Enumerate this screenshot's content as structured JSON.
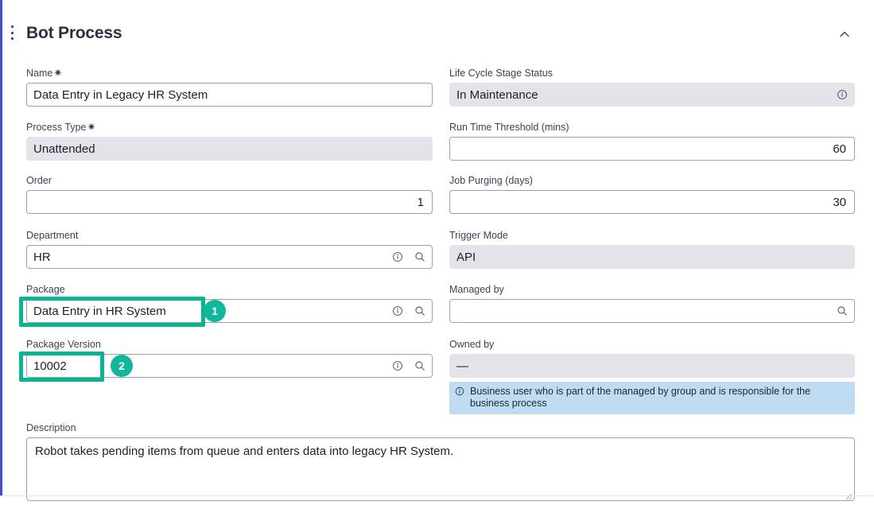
{
  "panel": {
    "title": "Bot Process",
    "drag_handle_icon": "kebab-vertical-icon",
    "collapse_icon": "chevron-up-icon",
    "collapsed": false
  },
  "colors": {
    "accent_rail": "#4a4ad0",
    "annotation_teal": "#09b393",
    "badge_teal": "#0fb89b",
    "callout_blue": "#bfdcf2",
    "disabled_grey": "#e2e4e9"
  },
  "required_marker": "✷",
  "form": {
    "left_column": [
      {
        "key": "name",
        "label": "Name",
        "required": true,
        "value": "Data Entry in Legacy HR System",
        "placeholder": "",
        "disabled": false,
        "align": "left",
        "adornments": []
      },
      {
        "key": "process_type",
        "label": "Process Type",
        "required": true,
        "value": "Unattended",
        "placeholder": "",
        "disabled": true,
        "align": "left",
        "adornments": []
      },
      {
        "key": "order",
        "label": "Order",
        "required": false,
        "value": "1",
        "placeholder": "",
        "disabled": false,
        "align": "right",
        "adornments": []
      },
      {
        "key": "department",
        "label": "Department",
        "required": false,
        "value": "HR",
        "placeholder": "",
        "disabled": false,
        "align": "left",
        "adornments": [
          "info-icon",
          "search-icon"
        ]
      },
      {
        "key": "package",
        "label": "Package",
        "required": false,
        "value": "Data Entry in HR System",
        "placeholder": "",
        "disabled": false,
        "align": "left",
        "adornments": [
          "info-icon",
          "search-icon"
        ]
      },
      {
        "key": "package_version",
        "label": "Package Version",
        "required": false,
        "value": "10002",
        "placeholder": "",
        "disabled": false,
        "align": "left",
        "adornments": [
          "info-icon",
          "search-icon"
        ]
      }
    ],
    "right_column": [
      {
        "key": "life_cycle_stage_status",
        "label": "Life Cycle Stage Status",
        "required": false,
        "value": "In Maintenance",
        "placeholder": "",
        "disabled": true,
        "align": "left",
        "adornments": [
          "info-icon"
        ]
      },
      {
        "key": "run_time_threshold",
        "label": "Run Time Threshold (mins)",
        "required": false,
        "value": "60",
        "placeholder": "",
        "disabled": false,
        "align": "right",
        "adornments": []
      },
      {
        "key": "job_purging",
        "label": "Job Purging (days)",
        "required": false,
        "value": "30",
        "placeholder": "",
        "disabled": false,
        "align": "right",
        "adornments": []
      },
      {
        "key": "trigger_mode",
        "label": "Trigger Mode",
        "required": false,
        "value": "API",
        "placeholder": "",
        "disabled": true,
        "align": "left",
        "adornments": []
      },
      {
        "key": "managed_by",
        "label": "Managed by",
        "required": false,
        "value": "",
        "placeholder": "",
        "disabled": false,
        "align": "left",
        "adornments": [
          "search-icon"
        ]
      },
      {
        "key": "owned_by",
        "label": "Owned by",
        "required": false,
        "value": "—",
        "placeholder": "",
        "disabled": true,
        "align": "left",
        "adornments": []
      }
    ],
    "owned_by_callout": {
      "icon": "info-circle-icon",
      "text": "Business user who is part of the managed by group and is responsible for the business process"
    },
    "description": {
      "label": "Description",
      "value": "Robot takes pending items from queue and enters data into legacy HR System.",
      "placeholder": "",
      "resize_handle_icon": "resize-grip-icon"
    }
  },
  "annotations": [
    {
      "number": "1",
      "target": "package-field"
    },
    {
      "number": "2",
      "target": "package-version-field"
    }
  ]
}
